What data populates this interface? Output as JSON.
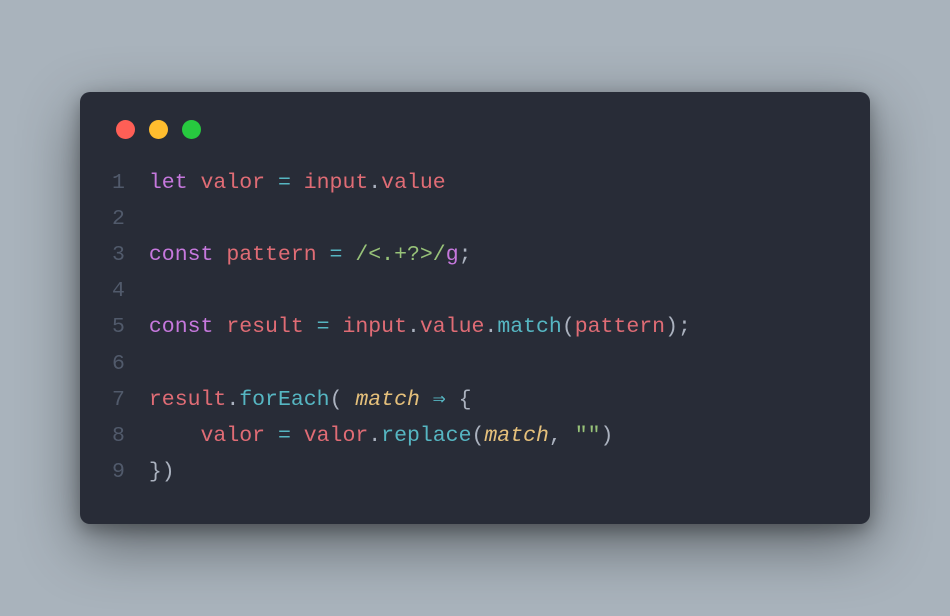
{
  "traffic_lights": {
    "red": "#ff5f56",
    "yellow": "#ffbd2e",
    "green": "#27c93f"
  },
  "code": {
    "line_numbers": [
      "1",
      "2",
      "3",
      "4",
      "5",
      "6",
      "7",
      "8",
      "9"
    ],
    "lines": [
      [
        {
          "t": "let ",
          "c": "tok-kw"
        },
        {
          "t": "valor ",
          "c": "tok-var"
        },
        {
          "t": "= ",
          "c": "tok-op"
        },
        {
          "t": "input",
          "c": "tok-var"
        },
        {
          "t": ".",
          "c": "tok-punc"
        },
        {
          "t": "value",
          "c": "tok-prop"
        }
      ],
      [],
      [
        {
          "t": "const ",
          "c": "tok-kw"
        },
        {
          "t": "pattern ",
          "c": "tok-var"
        },
        {
          "t": "= ",
          "c": "tok-op"
        },
        {
          "t": "/<.+?>/",
          "c": "tok-regex"
        },
        {
          "t": "g",
          "c": "tok-kw"
        },
        {
          "t": ";",
          "c": "tok-punc"
        }
      ],
      [],
      [
        {
          "t": "const ",
          "c": "tok-kw"
        },
        {
          "t": "result ",
          "c": "tok-var"
        },
        {
          "t": "= ",
          "c": "tok-op"
        },
        {
          "t": "input",
          "c": "tok-var"
        },
        {
          "t": ".",
          "c": "tok-punc"
        },
        {
          "t": "value",
          "c": "tok-prop"
        },
        {
          "t": ".",
          "c": "tok-punc"
        },
        {
          "t": "match",
          "c": "tok-fn"
        },
        {
          "t": "(",
          "c": "tok-punc"
        },
        {
          "t": "pattern",
          "c": "tok-var"
        },
        {
          "t": ");",
          "c": "tok-punc"
        }
      ],
      [],
      [
        {
          "t": "result",
          "c": "tok-var"
        },
        {
          "t": ".",
          "c": "tok-punc"
        },
        {
          "t": "forEach",
          "c": "tok-fn"
        },
        {
          "t": "( ",
          "c": "tok-punc"
        },
        {
          "t": "match",
          "c": "tok-param"
        },
        {
          "t": " ",
          "c": "tok-plain"
        },
        {
          "t": "⇒",
          "c": "tok-op"
        },
        {
          "t": " {",
          "c": "tok-punc"
        }
      ],
      [
        {
          "t": "    ",
          "c": "tok-plain"
        },
        {
          "t": "valor ",
          "c": "tok-var"
        },
        {
          "t": "= ",
          "c": "tok-op"
        },
        {
          "t": "valor",
          "c": "tok-var"
        },
        {
          "t": ".",
          "c": "tok-punc"
        },
        {
          "t": "replace",
          "c": "tok-fn"
        },
        {
          "t": "(",
          "c": "tok-punc"
        },
        {
          "t": "match",
          "c": "tok-param"
        },
        {
          "t": ", ",
          "c": "tok-punc"
        },
        {
          "t": "\"\"",
          "c": "tok-str"
        },
        {
          "t": ")",
          "c": "tok-punc"
        }
      ],
      [
        {
          "t": "})",
          "c": "tok-punc"
        }
      ]
    ]
  }
}
